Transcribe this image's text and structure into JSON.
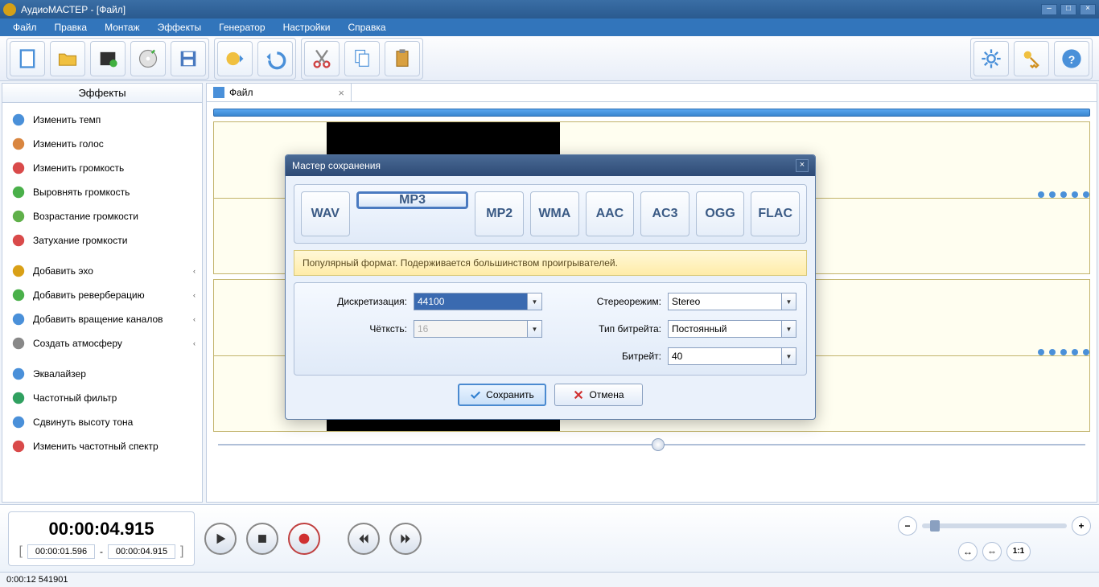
{
  "title": "АудиоМАСТЕР - [Файл]",
  "menu": [
    "Файл",
    "Правка",
    "Монтаж",
    "Эффекты",
    "Генератор",
    "Настройки",
    "Справка"
  ],
  "sidebar": {
    "title": "Эффекты",
    "groups": [
      [
        {
          "label": "Изменить темп",
          "color": "#4a90d9",
          "expand": false
        },
        {
          "label": "Изменить голос",
          "color": "#d98640",
          "expand": false
        },
        {
          "label": "Изменить громкость",
          "color": "#d94a4a",
          "expand": false
        },
        {
          "label": "Выровнять громкость",
          "color": "#4ab04a",
          "expand": false
        },
        {
          "label": "Возрастание громкости",
          "color": "#60b04a",
          "expand": false
        },
        {
          "label": "Затухание громкости",
          "color": "#d94a4a",
          "expand": false
        }
      ],
      [
        {
          "label": "Добавить эхо",
          "color": "#d9a017",
          "expand": true
        },
        {
          "label": "Добавить реверберацию",
          "color": "#4ab04a",
          "expand": true
        },
        {
          "label": "Добавить вращение каналов",
          "color": "#4a90d9",
          "expand": true
        },
        {
          "label": "Создать атмосферу",
          "color": "#888",
          "expand": true
        }
      ],
      [
        {
          "label": "Эквалайзер",
          "color": "#4a90d9",
          "expand": false
        },
        {
          "label": "Частотный фильтр",
          "color": "#30a060",
          "expand": false
        },
        {
          "label": "Сдвинуть высоту тона",
          "color": "#4a90d9",
          "expand": false
        },
        {
          "label": "Изменить частотный спектр",
          "color": "#d94a4a",
          "expand": false
        }
      ]
    ]
  },
  "filetab": {
    "name": "Файл"
  },
  "transport": {
    "big_time": "00:00:04.915",
    "from": "00:00:01.596",
    "to": "00:00:04.915"
  },
  "status": "0:00:12 541901",
  "zoom": {
    "fit": "1:1"
  },
  "modal": {
    "title": "Мастер сохранения",
    "formats": [
      "WAV",
      "MP3",
      "MP2",
      "WMA",
      "AAC",
      "AC3",
      "OGG",
      "FLAC"
    ],
    "selected_format": "MP3",
    "desc": "Популярный формат. Подерживается большинством проигрывателей.",
    "labels": {
      "sample": "Дискретизация:",
      "depth": "Чётксть:",
      "stereo": "Стереорежим:",
      "brtype": "Тип битрейта:",
      "bitrate": "Битрейт:"
    },
    "values": {
      "sample": "44100",
      "depth": "16",
      "stereo": "Stereo",
      "brtype": "Постоянный",
      "bitrate": "40"
    },
    "save": "Сохранить",
    "cancel": "Отмена"
  }
}
